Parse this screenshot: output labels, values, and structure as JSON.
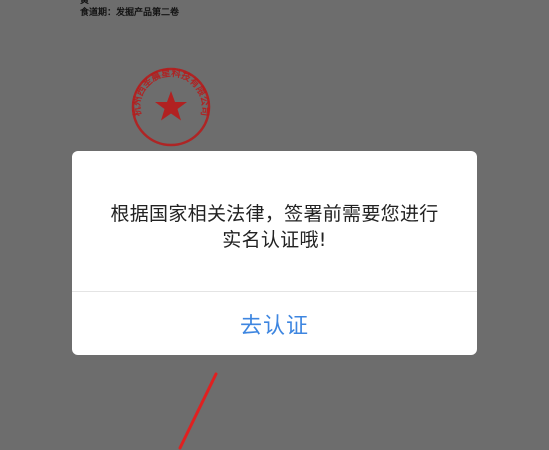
{
  "document": {
    "line1": "黄",
    "line2": "食道期：发掘产品第二卷",
    "seal_text": "杭州西圣晨星科技有限公司"
  },
  "dialog": {
    "message_line1": "根据国家相关法律，签署前需要您进行",
    "message_line2": "实名认证哦!",
    "button_label": "去认证"
  },
  "colors": {
    "overlay": "#6c6c6c",
    "dialog_bg": "#ffffff",
    "button_text": "#3e86e0",
    "seal": "#b51d1d",
    "arrow": "#e02020"
  }
}
